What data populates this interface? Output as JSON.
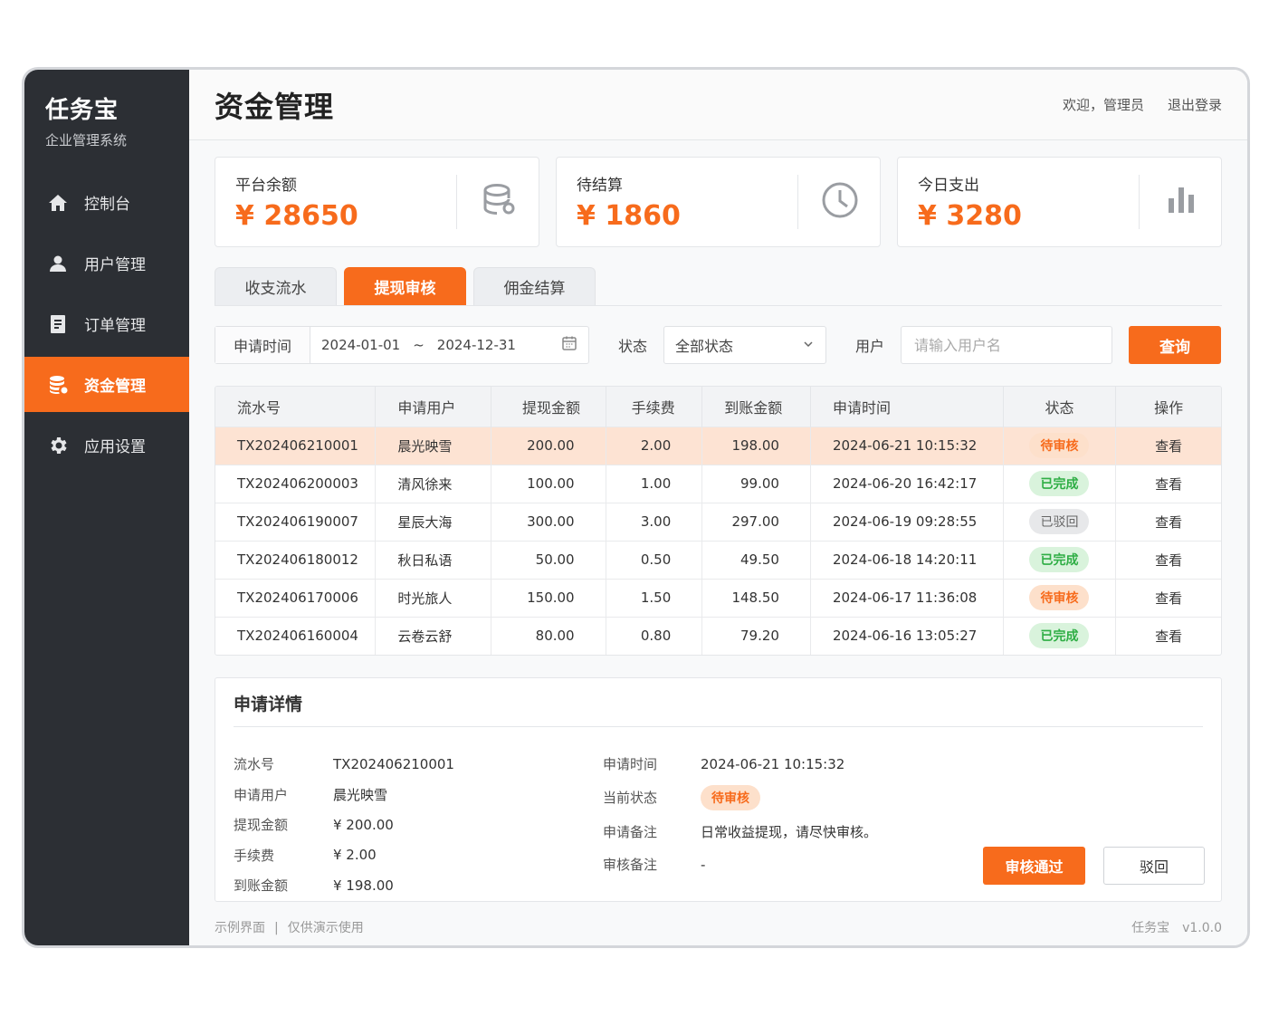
{
  "brand": {
    "title": "任务宝",
    "subtitle": "企业管理系统"
  },
  "sidebar": {
    "items": [
      {
        "label": "控制台",
        "icon": "home-icon"
      },
      {
        "label": "用户管理",
        "icon": "user-icon"
      },
      {
        "label": "订单管理",
        "icon": "document-icon"
      },
      {
        "label": "资金管理",
        "icon": "database-icon",
        "active": true
      },
      {
        "label": "应用设置",
        "icon": "gear-icon"
      }
    ]
  },
  "header": {
    "title": "资金管理",
    "welcome": "欢迎，管理员",
    "logout": "退出登录"
  },
  "cards": [
    {
      "label": "平台余额",
      "value": "¥ 28650",
      "icon": "database-icon"
    },
    {
      "label": "待结算",
      "value": "¥ 1860",
      "icon": "clock-icon"
    },
    {
      "label": "今日支出",
      "value": "¥ 3280",
      "icon": "bar-chart-icon"
    }
  ],
  "tabs": [
    {
      "label": "收支流水"
    },
    {
      "label": "提现审核",
      "active": true
    },
    {
      "label": "佣金结算"
    }
  ],
  "filter": {
    "date_label": "申请时间",
    "date_start": "2024-01-01",
    "date_sep": "~",
    "date_end": "2024-12-31",
    "status_label": "状态",
    "status_value": "全部状态",
    "user_label": "用户",
    "user_placeholder": "请输入用户名",
    "query": "查询"
  },
  "table": {
    "headers": [
      "流水号",
      "申请用户",
      "提现金额",
      "手续费",
      "到账金额",
      "申请时间",
      "状态",
      "操作"
    ],
    "rows": [
      {
        "id": "TX202406210001",
        "user": "晨光映雪",
        "amount": "200.00",
        "fee": "2.00",
        "received": "198.00",
        "time": "2024-06-21 10:15:32",
        "status": "待审核",
        "status_type": "pending",
        "action": "查看",
        "selected": true
      },
      {
        "id": "TX202406200003",
        "user": "清风徐来",
        "amount": "100.00",
        "fee": "1.00",
        "received": "99.00",
        "time": "2024-06-20 16:42:17",
        "status": "已完成",
        "status_type": "done",
        "action": "查看"
      },
      {
        "id": "TX202406190007",
        "user": "星辰大海",
        "amount": "300.00",
        "fee": "3.00",
        "received": "297.00",
        "time": "2024-06-19 09:28:55",
        "status": "已驳回",
        "status_type": "rejected",
        "action": "查看"
      },
      {
        "id": "TX202406180012",
        "user": "秋日私语",
        "amount": "50.00",
        "fee": "0.50",
        "received": "49.50",
        "time": "2024-06-18 14:20:11",
        "status": "已完成",
        "status_type": "done",
        "action": "查看"
      },
      {
        "id": "TX202406170006",
        "user": "时光旅人",
        "amount": "150.00",
        "fee": "1.50",
        "received": "148.50",
        "time": "2024-06-17 11:36:08",
        "status": "待审核",
        "status_type": "pending",
        "action": "查看"
      },
      {
        "id": "TX202406160004",
        "user": "云卷云舒",
        "amount": "80.00",
        "fee": "0.80",
        "received": "79.20",
        "time": "2024-06-16 13:05:27",
        "status": "已完成",
        "status_type": "done",
        "action": "查看"
      }
    ]
  },
  "detail": {
    "title": "申请详情",
    "left": [
      {
        "label": "流水号",
        "value": "TX202406210001"
      },
      {
        "label": "申请用户",
        "value": "晨光映雪"
      },
      {
        "label": "提现金额",
        "value": "¥ 200.00"
      },
      {
        "label": "手续费",
        "value": "¥ 2.00"
      },
      {
        "label": "到账金额",
        "value": "¥ 198.00"
      }
    ],
    "right": {
      "time_label": "申请时间",
      "time_value": "2024-06-21 10:15:32",
      "status_label": "当前状态",
      "status_value": "待审核",
      "note_label": "申请备注",
      "note_value": "日常收益提现，请尽快审核。",
      "review_label": "审核备注",
      "review_value": "-"
    },
    "approve": "审核通过",
    "reject": "驳回"
  },
  "footer": {
    "left1": "示例界面",
    "sep": "|",
    "left2": "仅供演示使用",
    "right": "任务宝　v1.0.0"
  },
  "colors": {
    "accent": "#f76b1c",
    "sidebar": "#2c2f34",
    "success": "#2fae45"
  }
}
